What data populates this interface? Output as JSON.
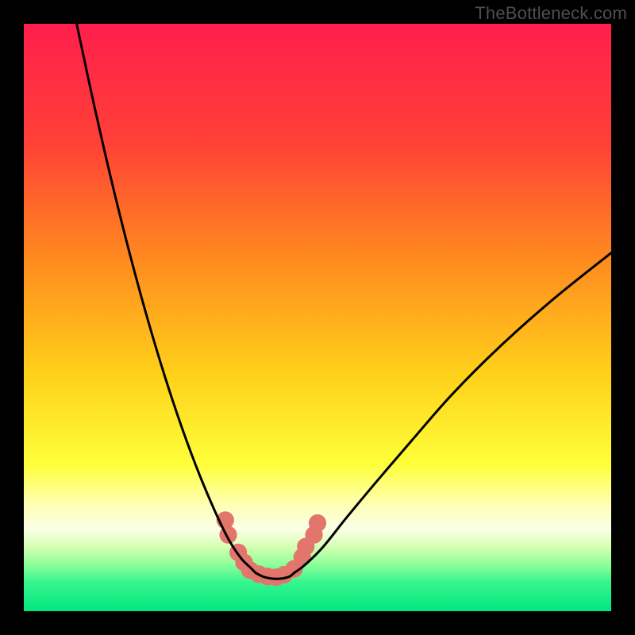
{
  "watermark": {
    "text": "TheBottleneck.com"
  },
  "chart_data": {
    "type": "line",
    "title": "",
    "xlabel": "",
    "ylabel": "",
    "xlim": [
      0,
      100
    ],
    "ylim": [
      0,
      100
    ],
    "grid": false,
    "legend": false,
    "background_gradient": {
      "stops": [
        {
          "offset": 0.0,
          "color": "#ff1e4d"
        },
        {
          "offset": 0.2,
          "color": "#ff4037"
        },
        {
          "offset": 0.4,
          "color": "#ff8a1f"
        },
        {
          "offset": 0.6,
          "color": "#ffd21a"
        },
        {
          "offset": 0.75,
          "color": "#feff3a"
        },
        {
          "offset": 0.82,
          "color": "#ffffb7"
        },
        {
          "offset": 0.86,
          "color": "#fbffe6"
        },
        {
          "offset": 0.89,
          "color": "#d6ffb3"
        },
        {
          "offset": 0.92,
          "color": "#8fff9a"
        },
        {
          "offset": 0.95,
          "color": "#38f58f"
        },
        {
          "offset": 1.0,
          "color": "#00e67d"
        }
      ]
    },
    "series": [
      {
        "name": "left-curve",
        "color": "#000000",
        "x": [
          9,
          12,
          15,
          18,
          21,
          24,
          27,
          30,
          33,
          35,
          37,
          38.5,
          39.5
        ],
        "y": [
          100,
          86,
          73,
          61,
          50,
          40,
          31,
          23,
          16,
          12,
          9,
          7.5,
          6.5
        ]
      },
      {
        "name": "right-curve",
        "color": "#000000",
        "x": [
          46,
          48,
          51,
          55,
          60,
          66,
          73,
          81,
          90,
          100
        ],
        "y": [
          6.5,
          8,
          11,
          16,
          22,
          29,
          37,
          45,
          53,
          61
        ]
      },
      {
        "name": "floor-segment",
        "color": "#000000",
        "x": [
          39.5,
          41,
          43,
          45,
          46
        ],
        "y": [
          6.5,
          5.8,
          5.5,
          5.8,
          6.5
        ]
      }
    ],
    "markers": {
      "name": "salmon-markers",
      "color": "#e2756c",
      "radius_pct": 1.5,
      "points": [
        {
          "x": 34.3,
          "y": 15.5
        },
        {
          "x": 34.8,
          "y": 13.0
        },
        {
          "x": 36.5,
          "y": 10.0
        },
        {
          "x": 37.5,
          "y": 8.3
        },
        {
          "x": 38.5,
          "y": 7.0
        },
        {
          "x": 40.0,
          "y": 6.3
        },
        {
          "x": 41.5,
          "y": 5.9
        },
        {
          "x": 43.0,
          "y": 5.8
        },
        {
          "x": 44.3,
          "y": 6.2
        },
        {
          "x": 46.0,
          "y": 7.2
        },
        {
          "x": 47.4,
          "y": 9.2
        },
        {
          "x": 48.0,
          "y": 11.0
        },
        {
          "x": 49.4,
          "y": 13.0
        },
        {
          "x": 50.0,
          "y": 15.0
        }
      ]
    }
  }
}
